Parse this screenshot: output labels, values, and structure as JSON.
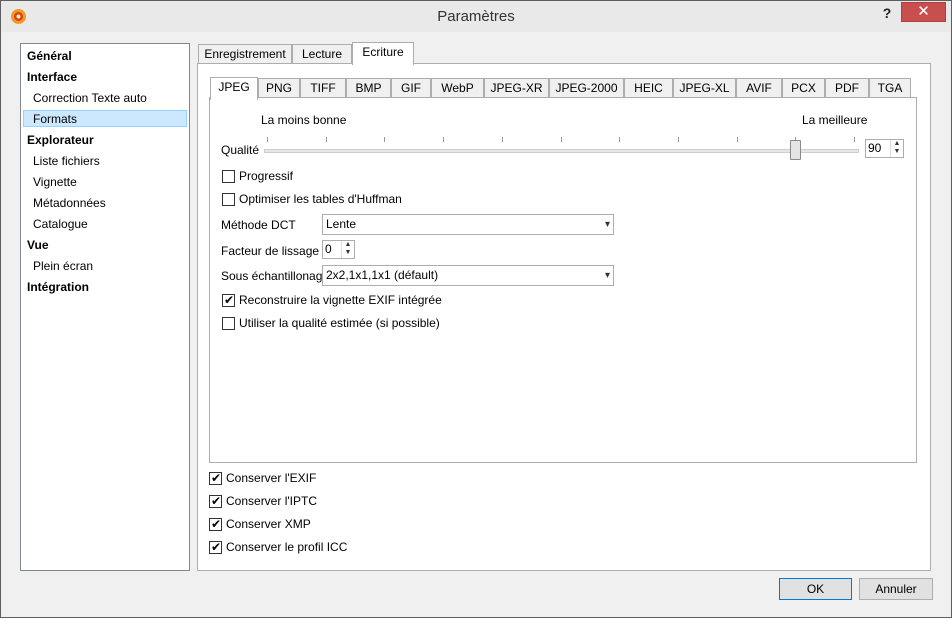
{
  "window": {
    "title": "Paramètres",
    "help": "?",
    "close": "✕"
  },
  "nav": {
    "items": [
      {
        "label": "Général",
        "level": 0
      },
      {
        "label": "Interface",
        "level": 0
      },
      {
        "label": "Correction Texte auto",
        "level": 1
      },
      {
        "label": "Formats",
        "level": 1,
        "selected": true
      },
      {
        "label": "Explorateur",
        "level": 0
      },
      {
        "label": "Liste fichiers",
        "level": 1
      },
      {
        "label": "Vignette",
        "level": 1
      },
      {
        "label": "Métadonnées",
        "level": 1
      },
      {
        "label": "Catalogue",
        "level": 1
      },
      {
        "label": "Vue",
        "level": 0
      },
      {
        "label": "Plein écran",
        "level": 1
      },
      {
        "label": "Intégration",
        "level": 0
      }
    ]
  },
  "top_tabs": [
    "Enregistrement",
    "Lecture",
    "Ecriture"
  ],
  "format_tabs": [
    "JPEG",
    "PNG",
    "TIFF",
    "BMP",
    "GIF",
    "WebP",
    "JPEG-XR",
    "JPEG-2000",
    "HEIC",
    "JPEG-XL",
    "AVIF",
    "PCX",
    "PDF",
    "TGA"
  ],
  "jpeg": {
    "quality_label": "Qualité",
    "min_label": "La moins bonne",
    "max_label": "La meilleure",
    "quality_value": "90",
    "quality_fraction": 0.9,
    "progressive": {
      "label": "Progressif",
      "checked": false
    },
    "huffman": {
      "label": "Optimiser les tables d'Huffman",
      "checked": false
    },
    "dct_label": "Méthode DCT",
    "dct_value": "Lente",
    "smoothing_label": "Facteur de lissage",
    "smoothing_value": "0",
    "subsampling_label": "Sous échantillonage",
    "subsampling_value": "2x2,1x1,1x1 (défault)",
    "rebuild_exif": {
      "label": "Reconstruire la vignette EXIF intégrée",
      "checked": true
    },
    "estimated_quality": {
      "label": "Utiliser la qualité estimée (si possible)",
      "checked": false
    }
  },
  "keep": {
    "exif": {
      "label": "Conserver l'EXIF",
      "checked": true
    },
    "iptc": {
      "label": "Conserver l'IPTC",
      "checked": true
    },
    "xmp": {
      "label": "Conserver XMP",
      "checked": true
    },
    "icc": {
      "label": "Conserver le profil ICC",
      "checked": true
    }
  },
  "buttons": {
    "ok": "OK",
    "cancel": "Annuler"
  },
  "check_mark": "✔",
  "dropdown_arrow": "▾",
  "spin_up": "▲",
  "spin_down": "▼"
}
